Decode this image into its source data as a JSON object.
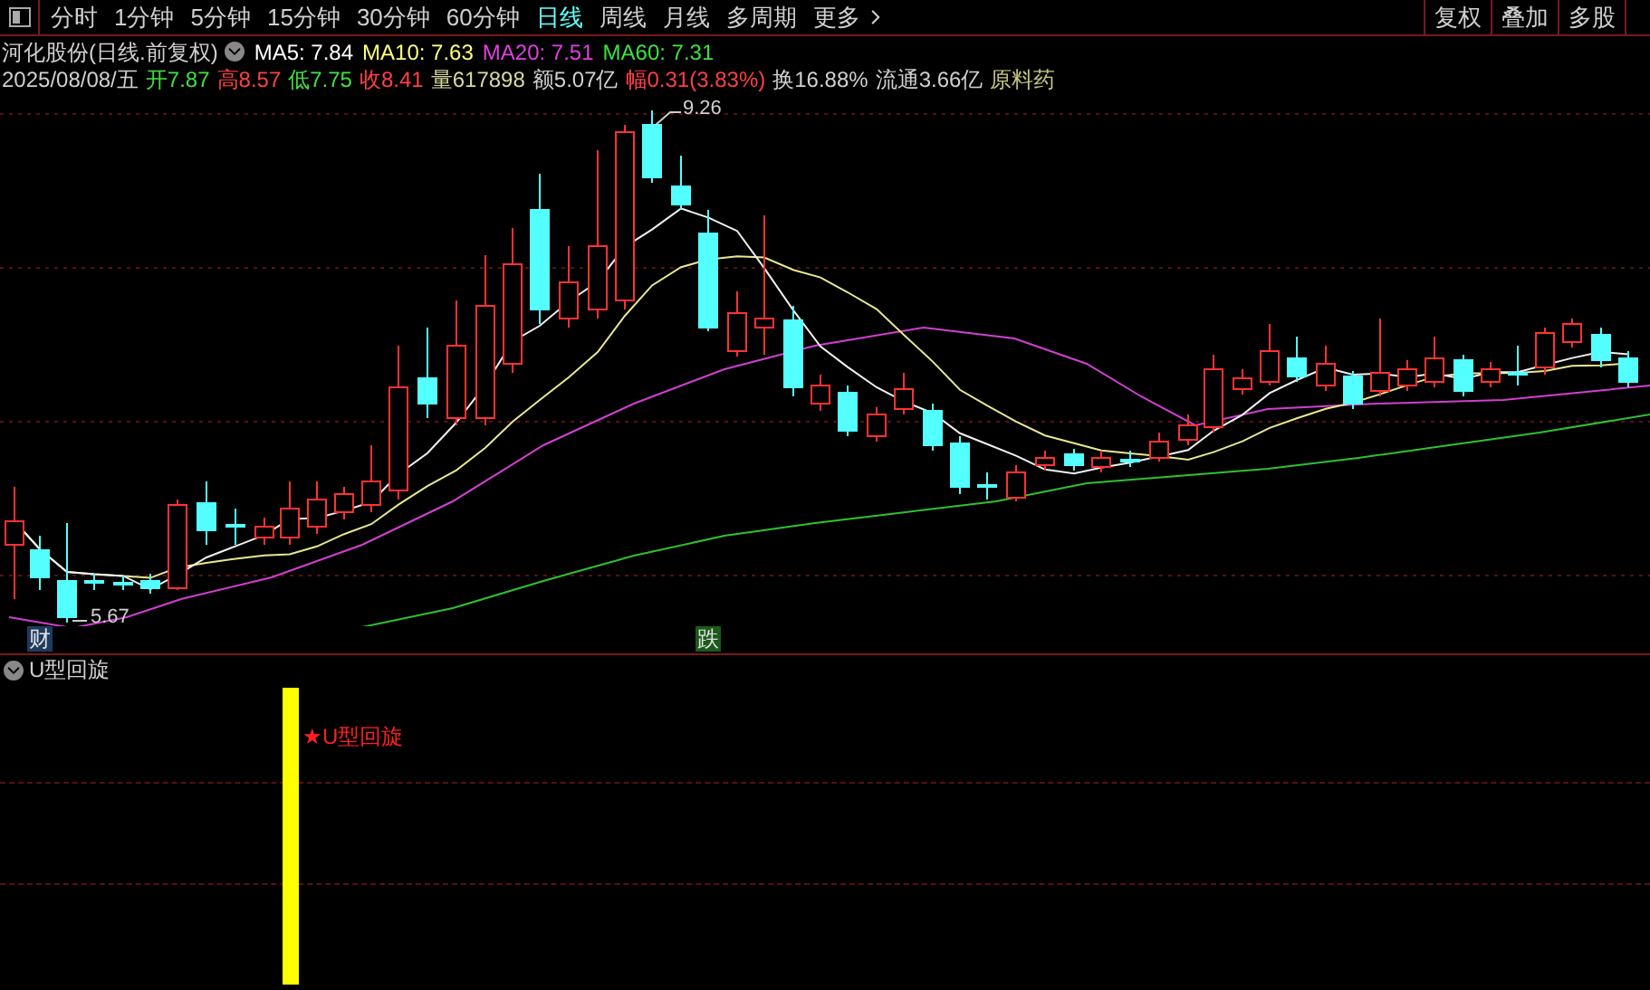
{
  "toolbar": {
    "tabs": [
      {
        "label": "分时",
        "selected": false
      },
      {
        "label": "1分钟",
        "selected": false
      },
      {
        "label": "5分钟",
        "selected": false
      },
      {
        "label": "15分钟",
        "selected": false
      },
      {
        "label": "30分钟",
        "selected": false
      },
      {
        "label": "60分钟",
        "selected": false
      },
      {
        "label": "日线",
        "selected": true
      },
      {
        "label": "周线",
        "selected": false
      },
      {
        "label": "月线",
        "selected": false
      },
      {
        "label": "多周期",
        "selected": false
      },
      {
        "label": "更多",
        "selected": false
      }
    ],
    "buttons": [
      "复权",
      "叠加",
      "多股"
    ]
  },
  "quote_header": {
    "name": "河化股份(日线.前复权)",
    "ma": [
      {
        "label": "MA5: 7.84",
        "color": "#ffffff"
      },
      {
        "label": "MA10: 7.63",
        "color": "#ffff80"
      },
      {
        "label": "MA20: 7.51",
        "color": "#e040e0"
      },
      {
        "label": "MA60: 7.31",
        "color": "#40e040"
      }
    ]
  },
  "quote_line": [
    {
      "label": "2025/08/08/五",
      "color": "#d0d0d0"
    },
    {
      "label": "开",
      "value": "7.87",
      "color": "#40e040"
    },
    {
      "label": "高",
      "value": "8.57",
      "color": "#ff4040"
    },
    {
      "label": "低",
      "value": "7.75",
      "color": "#40e040"
    },
    {
      "label": "收",
      "value": "8.41",
      "color": "#ff4040"
    },
    {
      "label": "量",
      "value": "617898",
      "color": "#d8d8a0"
    },
    {
      "label": "额",
      "value": "5.07亿",
      "color": "#d0d0d0"
    },
    {
      "label": "幅",
      "value": "0.31(3.83%)",
      "color": "#ff4040"
    },
    {
      "label": "换",
      "value": "16.88%",
      "color": "#d0d0d0"
    },
    {
      "label": "流通",
      "value": "3.66亿",
      "color": "#d0d0d0"
    },
    {
      "label": "原料药",
      "color": "#c8c880"
    }
  ],
  "chart": {
    "high_label": "9.26",
    "low_label": "5.67",
    "markers": [
      {
        "text": "财",
        "color": "#1e3a5f"
      },
      {
        "text": "跌",
        "color": "#1a5a1a"
      }
    ]
  },
  "indicator": {
    "title": "U型回旋",
    "signal_label": "★U型回旋"
  }
}
